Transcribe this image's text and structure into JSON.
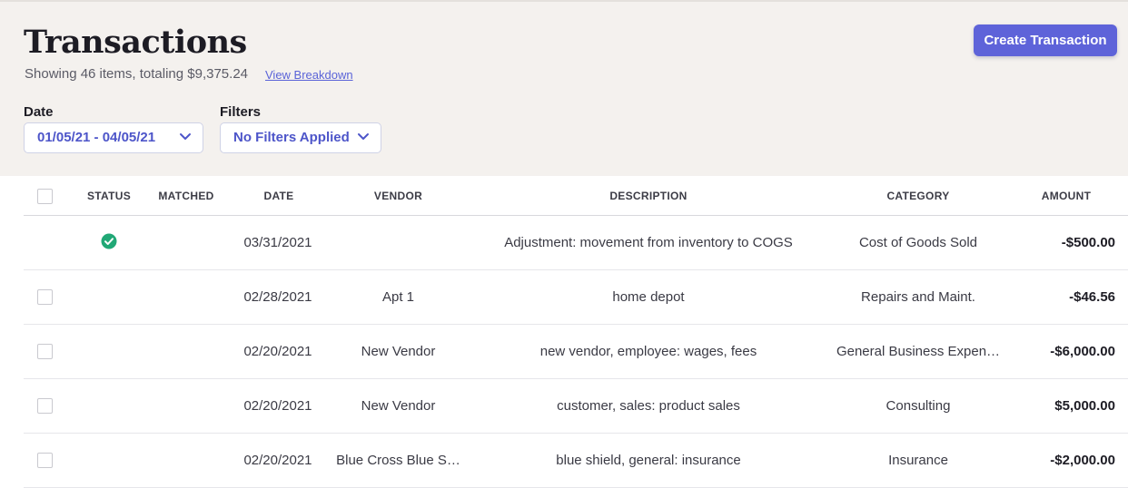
{
  "header": {
    "title": "Transactions",
    "summary": "Showing 46 items, totaling $9,375.24",
    "breakdown_link": "View Breakdown",
    "create_button": "Create Transaction"
  },
  "filters": {
    "date_label": "Date",
    "date_value": "01/05/21 - 04/05/21",
    "filters_label": "Filters",
    "filters_value": "No Filters Applied"
  },
  "table": {
    "columns": [
      "STATUS",
      "MATCHED",
      "DATE",
      "VENDOR",
      "DESCRIPTION",
      "CATEGORY",
      "AMOUNT"
    ],
    "rows": [
      {
        "status": "matched-check",
        "date": "03/31/2021",
        "vendor": "",
        "description": "Adjustment: movement from inventory to COGS",
        "category": "Cost of Goods Sold",
        "amount": "-$500.00"
      },
      {
        "status": "",
        "date": "02/28/2021",
        "vendor": "Apt 1",
        "description": "home depot",
        "category": "Repairs and Maint.",
        "amount": "-$46.56"
      },
      {
        "status": "",
        "date": "02/20/2021",
        "vendor": "New Vendor",
        "description": "new vendor, employee: wages, fees",
        "category": "General Business Expen…",
        "amount": "-$6,000.00"
      },
      {
        "status": "",
        "date": "02/20/2021",
        "vendor": "New Vendor",
        "description": "customer, sales: product sales",
        "category": "Consulting",
        "amount": "$5,000.00"
      },
      {
        "status": "",
        "date": "02/20/2021",
        "vendor": "Blue Cross Blue S…",
        "description": "blue shield, general: insurance",
        "category": "Insurance",
        "amount": "-$2,000.00"
      }
    ]
  },
  "colors": {
    "accent": "#5e63d9",
    "header_bg": "#f4f1ee",
    "status_ok": "#21a876"
  }
}
